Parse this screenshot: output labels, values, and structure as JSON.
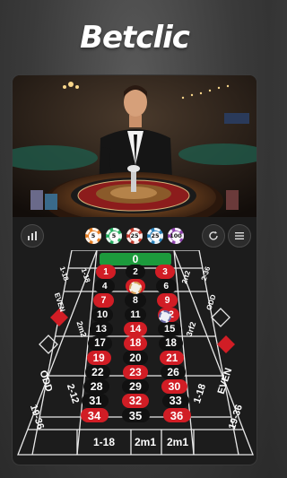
{
  "app": {
    "brand": "Betclic"
  },
  "toolbar": {
    "chips": [
      {
        "label": "5",
        "color": "#e67e22"
      },
      {
        "label": "5",
        "color": "#27ae60"
      },
      {
        "label": "25",
        "color": "#c0392b"
      },
      {
        "label": "25",
        "color": "#2980b9"
      },
      {
        "label": "100",
        "color": "#8e44ad"
      }
    ]
  },
  "table": {
    "zero": "0",
    "rows": [
      [
        {
          "n": "1",
          "c": "red"
        },
        {
          "n": "2",
          "c": "black"
        },
        {
          "n": "3",
          "c": "red"
        }
      ],
      [
        {
          "n": "4",
          "c": "black"
        },
        {
          "n": "5",
          "c": "red"
        },
        {
          "n": "6",
          "c": "black"
        }
      ],
      [
        {
          "n": "7",
          "c": "red"
        },
        {
          "n": "8",
          "c": "black"
        },
        {
          "n": "9",
          "c": "red"
        }
      ],
      [
        {
          "n": "10",
          "c": "black"
        },
        {
          "n": "11",
          "c": "black"
        },
        {
          "n": "12",
          "c": "red"
        }
      ],
      [
        {
          "n": "13",
          "c": "black"
        },
        {
          "n": "14",
          "c": "red"
        },
        {
          "n": "15",
          "c": "black"
        }
      ],
      [
        {
          "n": "17",
          "c": "black"
        },
        {
          "n": "18",
          "c": "red"
        },
        {
          "n": "18",
          "c": "black"
        }
      ],
      [
        {
          "n": "19",
          "c": "red"
        },
        {
          "n": "20",
          "c": "black"
        },
        {
          "n": "21",
          "c": "red"
        }
      ],
      [
        {
          "n": "22",
          "c": "black"
        },
        {
          "n": "23",
          "c": "red"
        },
        {
          "n": "26",
          "c": "black"
        }
      ],
      [
        {
          "n": "28",
          "c": "black"
        },
        {
          "n": "29",
          "c": "black"
        },
        {
          "n": "30",
          "c": "red"
        }
      ],
      [
        {
          "n": "31",
          "c": "black"
        },
        {
          "n": "32",
          "c": "red"
        },
        {
          "n": "33",
          "c": "black"
        }
      ],
      [
        {
          "n": "34",
          "c": "red"
        },
        {
          "n": "35",
          "c": "black"
        },
        {
          "n": "36",
          "c": "red"
        }
      ]
    ],
    "bottom": [
      "1-18",
      "2m1",
      "2m1"
    ],
    "left_labels": [
      "1-18",
      "EVEN",
      "1-18",
      "2m2",
      "ODD",
      "2-12",
      "19-36"
    ],
    "right_labels": [
      "2-36",
      "2rt2",
      "ODD",
      "3rf2",
      "EVEN",
      "1-18",
      "19-36"
    ]
  }
}
